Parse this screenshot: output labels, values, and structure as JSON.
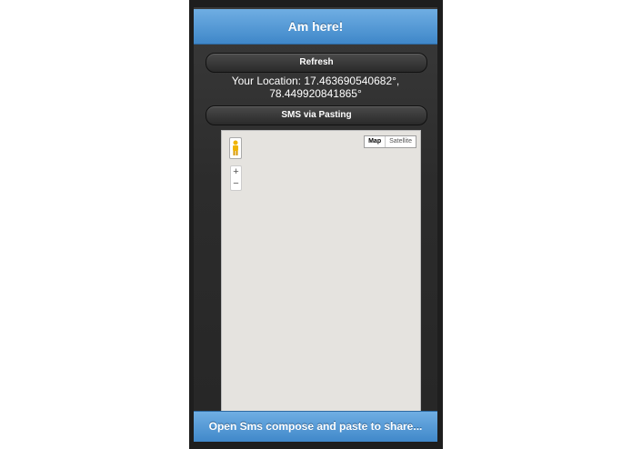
{
  "header": {
    "title": "Am here!"
  },
  "buttons": {
    "refresh": "Refresh",
    "sms_pasting": "SMS via Pasting"
  },
  "location": {
    "line1": "Your Location: 17.463690540682°,",
    "line2": "78.449920841865°"
  },
  "map": {
    "type_map": "Map",
    "type_satellite": "Satellite",
    "zoom_in": "+",
    "zoom_out": "−",
    "pegman_icon": "pegman-icon"
  },
  "footer": {
    "label": "Open Sms compose and paste to share..."
  },
  "colors": {
    "accent": "#4f97d6",
    "background": "#2c2c2c",
    "map_bg": "#e5e3df"
  }
}
